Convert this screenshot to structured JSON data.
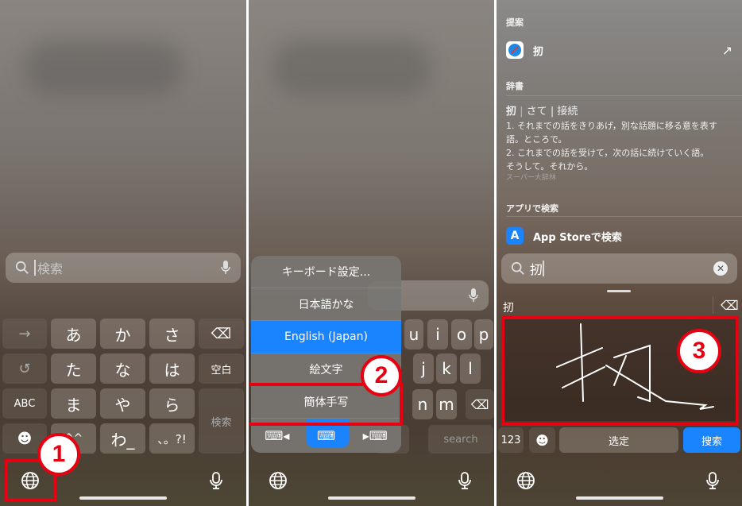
{
  "panel1": {
    "search_placeholder": "検索",
    "keys": {
      "r1": [
        "→",
        "あ",
        "か",
        "さ"
      ],
      "r2": [
        "た",
        "な",
        "は"
      ],
      "space": "空白",
      "r3": [
        "ABC",
        "ま",
        "や",
        "ら"
      ],
      "r4": [
        "^^",
        "わ_",
        "、。?!"
      ],
      "return": "検索"
    },
    "badge": "1"
  },
  "panel2": {
    "menu": [
      "キーボード設定...",
      "日本語かな",
      "English (Japan)",
      "絵文字",
      "簡体手写"
    ],
    "selected": "English (Japan)",
    "keys_r1": [
      "u",
      "i",
      "o",
      "p"
    ],
    "keys_r2": [
      "j",
      "k",
      "l"
    ],
    "keys_r3": [
      "n",
      "m"
    ],
    "search_key": "search",
    "badge": "2"
  },
  "panel3": {
    "section_suggest": "提案",
    "suggest_item": "扨",
    "section_dict": "辞書",
    "dict_head": [
      "扨",
      "さて",
      "接続"
    ],
    "dict_lines": [
      "1. それまでの話をきりあげ，別な話題に移る意を表す",
      "語。ところで。",
      "2. これまでの話を受けて，次の話に続けていく語。",
      "そうして。それから。"
    ],
    "dict_source": "スーパー大辞林",
    "section_apps": "アプリで検索",
    "appstore_label": "App Storeで検索",
    "search_value": "扨",
    "candidate": "扨",
    "key_123": "123",
    "key_select": "选定",
    "key_search": "搜索",
    "badge": "3"
  },
  "colors": {
    "accent": "#1a84ff",
    "annotation": "#e60012"
  }
}
